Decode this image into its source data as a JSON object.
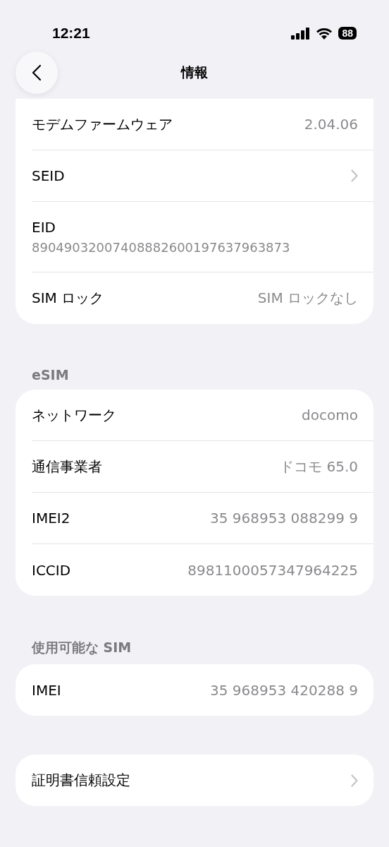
{
  "status_bar": {
    "time": "12:21",
    "battery": "88"
  },
  "nav": {
    "title": "情報"
  },
  "groups": [
    {
      "rows": [
        {
          "kind": "value",
          "label": "モデムファームウェア",
          "value": "2.04.06"
        },
        {
          "kind": "chevron",
          "label": "SEID"
        },
        {
          "kind": "stacked",
          "label": "EID",
          "value": "89049032007408882600197637963873"
        },
        {
          "kind": "value",
          "label": "SIM ロック",
          "value": "SIM ロックなし"
        }
      ]
    },
    {
      "header": "eSIM",
      "rows": [
        {
          "kind": "value",
          "label": "ネットワーク",
          "value": "docomo"
        },
        {
          "kind": "value",
          "label": "通信事業者",
          "value": "ドコモ 65.0"
        },
        {
          "kind": "value",
          "label": "IMEI2",
          "value": "35 968953 088299 9"
        },
        {
          "kind": "value",
          "label": "ICCID",
          "value": "8981100057347964225"
        }
      ]
    },
    {
      "header": "使用可能な SIM",
      "rows": [
        {
          "kind": "value",
          "label": "IMEI",
          "value": "35 968953 420288 9"
        }
      ]
    },
    {
      "rows": [
        {
          "kind": "chevron",
          "label": "証明書信頼設定"
        }
      ]
    }
  ]
}
